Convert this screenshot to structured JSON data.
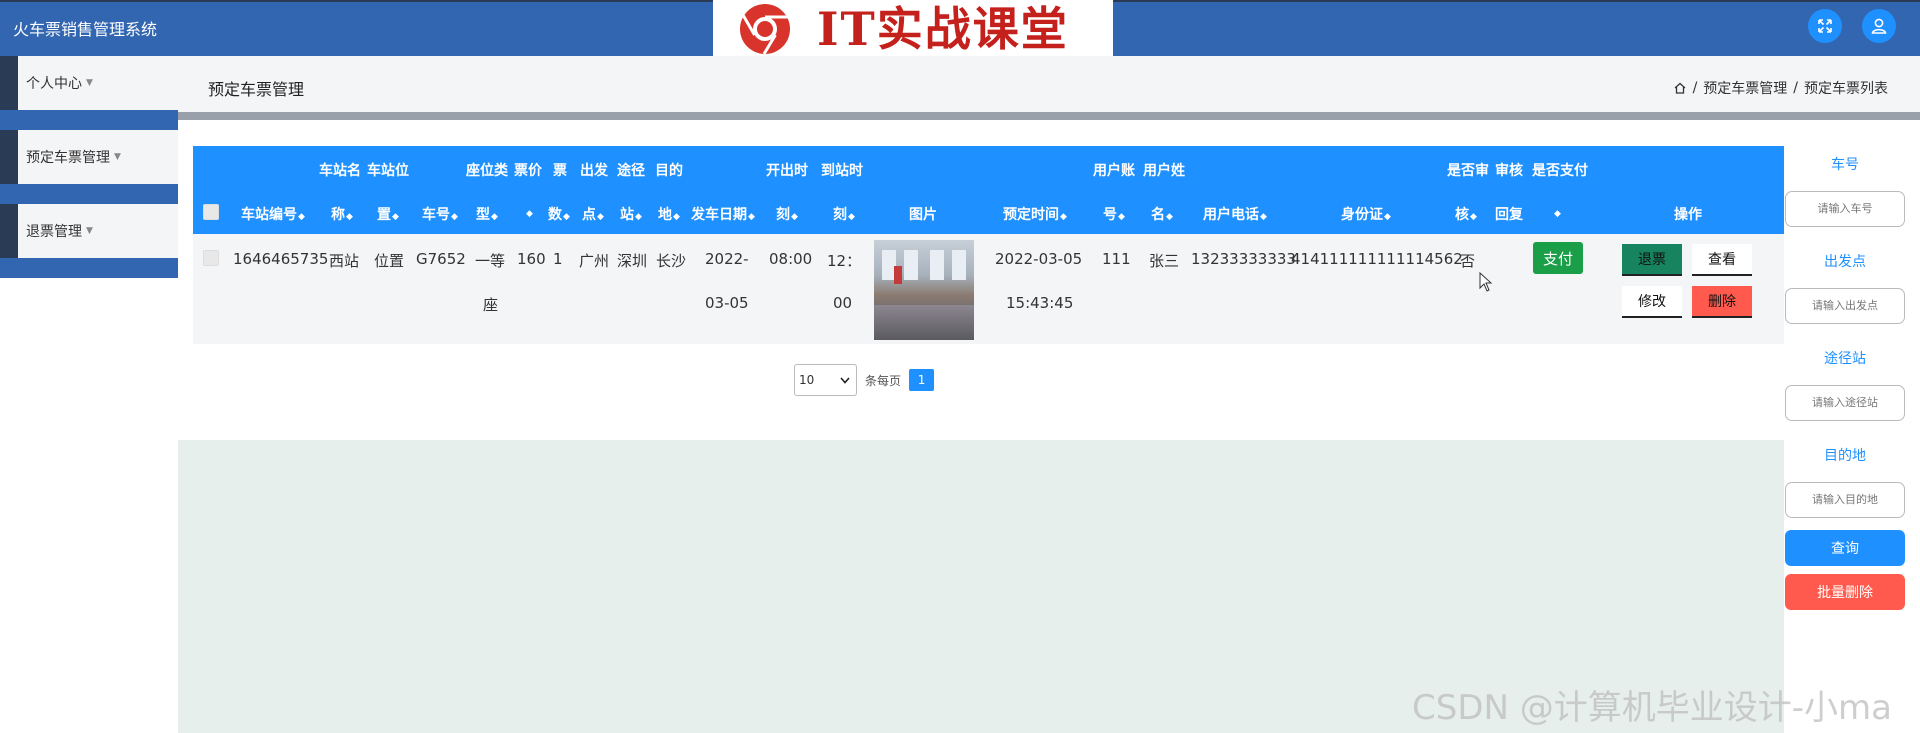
{
  "app": {
    "title": "火车票销售管理系统",
    "logo_text": "IT实战课堂"
  },
  "sidebar": {
    "items": [
      {
        "label": "个人中心"
      },
      {
        "label": "预定车票管理"
      },
      {
        "label": "退票管理"
      }
    ]
  },
  "header": {
    "page_title": "预定车票管理",
    "breadcrumb": [
      "预定车票管理",
      "预定车票列表"
    ]
  },
  "table": {
    "group_headers": [
      "车站名",
      "车站位",
      "座位类",
      "票价",
      "票",
      "出发",
      "途径",
      "目的",
      "开出时",
      "到站时",
      "用户账",
      "用户姓",
      "是否审",
      "审核",
      "是否支付"
    ],
    "columns": [
      "车站编号",
      "称",
      "置",
      "车号",
      "型",
      "",
      "数",
      "点",
      "站",
      "地",
      "发车日期",
      "刻",
      "刻",
      "图片",
      "预定时间",
      "号",
      "名",
      "用户电话",
      "身份证",
      "核",
      "回复",
      "",
      "操作"
    ],
    "rows": [
      {
        "station_no": "1646465735",
        "station_name": "西站",
        "station_pos": "位置",
        "train_no": "G7652",
        "seat_type_1": "一等",
        "seat_type_2": "座",
        "price": "160",
        "tickets": "1",
        "depart": "广州",
        "via": "深圳",
        "dest": "长沙",
        "date_1": "2022-",
        "date_2": "03-05",
        "depart_time": "08:00",
        "arrive_time_1": "12：",
        "arrive_time_2": "00",
        "book_date": "2022-03-05",
        "book_time": "15:43:45",
        "user_account": "111",
        "user_name": "张三",
        "phone": "13233333333",
        "id_card": "414111111111114562",
        "reviewed": "否",
        "reply": "",
        "actions": {
          "pay": "支付",
          "refund": "退票",
          "view": "查看",
          "edit": "修改",
          "delete": "删除"
        }
      }
    ]
  },
  "pagination": {
    "page_size": "10",
    "per_page_label": "条每页",
    "current_page": "1"
  },
  "search": {
    "train_no_label": "车号",
    "train_no_placeholder": "请输入车号",
    "depart_label": "出发点",
    "depart_placeholder": "请输入出发点",
    "via_label": "途径站",
    "via_placeholder": "请输入途径站",
    "dest_label": "目的地",
    "dest_placeholder": "请输入目的地",
    "query_button": "查询",
    "batch_delete_button": "批量删除"
  },
  "watermark": "CSDN @计算机毕业设计-小ma",
  "colors": {
    "topbar": "#3366b0",
    "primary": "#1e90ff",
    "pay": "#1a9e48",
    "delete": "#ff5a4d",
    "batch_delete": "#ff5a4d"
  }
}
